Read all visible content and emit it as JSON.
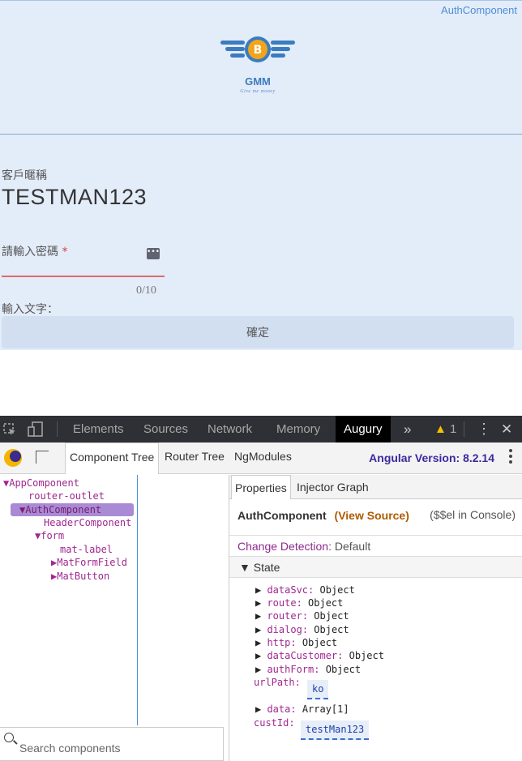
{
  "app": {
    "component_tag": "AuthComponent",
    "brand": "GMM",
    "slogan": "Give me money",
    "customer_label": "客戶暱稱",
    "customer_name": "TESTMAN123",
    "password_label": "請輸入密碼",
    "required_mark": "*",
    "password_counter": "0/10",
    "hint_label": "輸入文字：",
    "confirm_label": "確定",
    "colors": {
      "background": "#e3ecf9",
      "brand": "#3b7cc0",
      "error": "#e06a6a"
    }
  },
  "devtools": {
    "tabs": [
      "Elements",
      "Sources",
      "Network",
      "Memory",
      "Augury"
    ],
    "active_tab": "Augury",
    "more": "»",
    "warning_count": "1",
    "close": "✕"
  },
  "augury": {
    "tabs": [
      "Component Tree",
      "Router Tree",
      "NgModules"
    ],
    "angular_version": "Angular Version: 8.2.14",
    "tree": [
      {
        "label": "▼AppComponent"
      },
      {
        "label": "router-outlet"
      },
      {
        "label": "▼AuthComponent",
        "selected": true
      },
      {
        "label": "HeaderComponent"
      },
      {
        "label": "▼form"
      },
      {
        "label": "mat-label"
      },
      {
        "label": "▶MatFormField"
      },
      {
        "label": "▶MatButton"
      }
    ],
    "search_placeholder": "Search components",
    "props_tabs": [
      "Properties",
      "Injector Graph"
    ],
    "component_name": "AuthComponent",
    "view_source": "(View Source)",
    "console_hint": "($$el in Console)",
    "change_detection_key": "Change Detection",
    "change_detection_value": ": Default",
    "state_label": "▼  State",
    "state": [
      {
        "key": "dataSvc",
        "value": "Object"
      },
      {
        "key": "route",
        "value": "Object"
      },
      {
        "key": "router",
        "value": "Object"
      },
      {
        "key": "dialog",
        "value": "Object"
      },
      {
        "key": "http",
        "value": "Object"
      },
      {
        "key": "dataCustomer",
        "value": "Object"
      },
      {
        "key": "authForm",
        "value": "Object"
      }
    ],
    "url_path_key": "urlPath:",
    "url_path_value": "ko",
    "data_key": "data",
    "data_value": "Array[1]",
    "cust_id_key": "custId:",
    "cust_id_value": "testMan123"
  }
}
